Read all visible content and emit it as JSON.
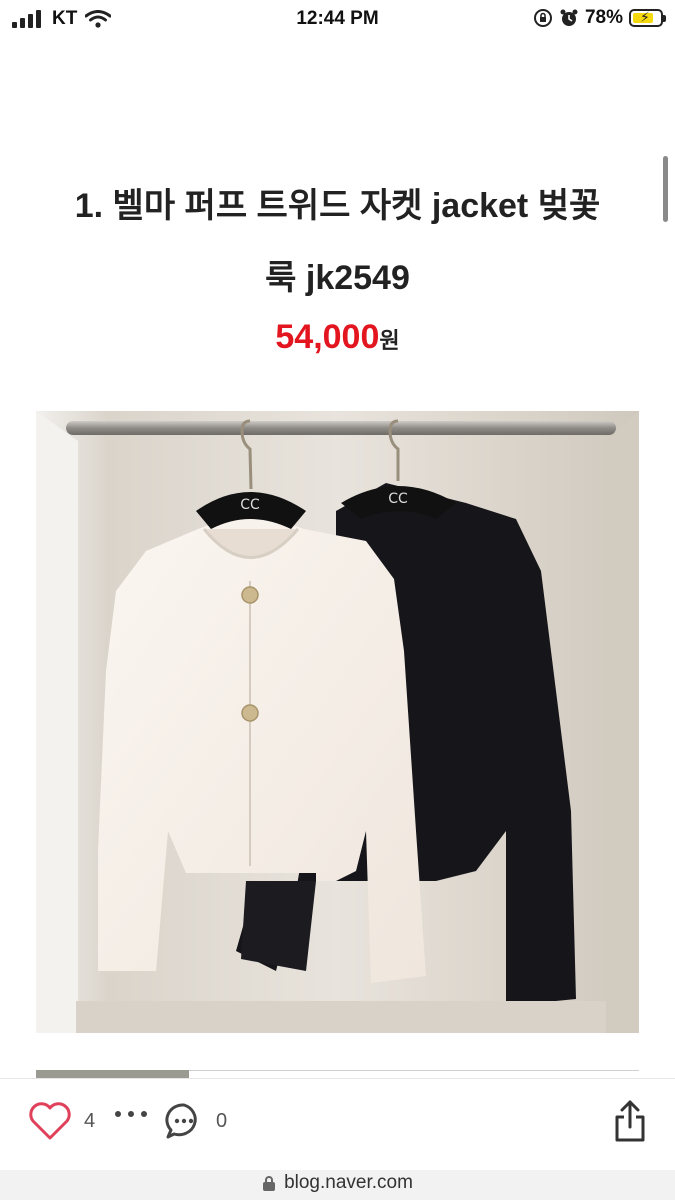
{
  "status": {
    "carrier": "KT",
    "time": "12:44 PM",
    "battery_percent": "78%",
    "battery_level": 0.78,
    "icons": [
      "signal-icon",
      "wifi-icon",
      "lock-rotation-icon",
      "alarm-icon",
      "battery-charging-icon"
    ]
  },
  "product": {
    "title_line1": "1. 벨마 퍼프 트위드 자켓 jacket 벚꽃",
    "title_line2": "룩 jk2549",
    "price": "54,000",
    "price_unit": "원",
    "accent_color": "#e3151f",
    "image": "two-tweed-jackets-on-hangers"
  },
  "toolbar": {
    "like_count": "4",
    "comment_count": "0",
    "icons": [
      "heart-icon",
      "more-icon",
      "comment-icon",
      "share-icon"
    ]
  },
  "browser": {
    "url": "blog.naver.com"
  }
}
